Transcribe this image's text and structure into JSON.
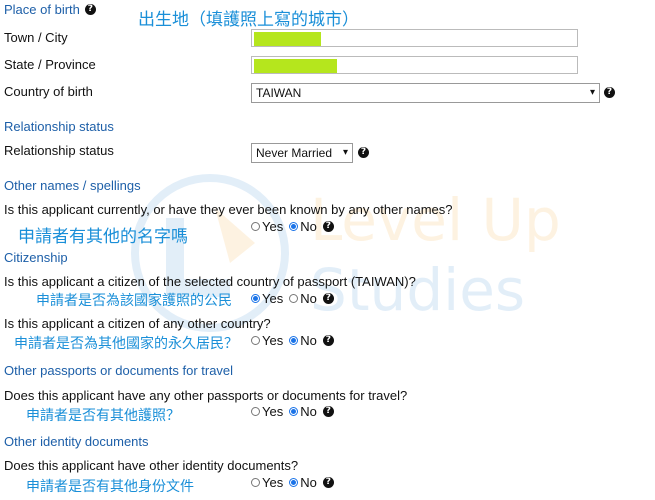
{
  "place_of_birth": {
    "section_title": "Place of birth",
    "annotation": "出生地（填護照上寫的城市）",
    "town_label": "Town / City",
    "state_label": "State / Province",
    "country_label": "Country of birth",
    "country_value": "TAIWAN"
  },
  "relationship": {
    "section_title": "Relationship status",
    "label": "Relationship status",
    "value": "Never Married"
  },
  "other_names": {
    "section_title": "Other names / spellings",
    "question": "Is this applicant currently, or have they ever been known by any other names?",
    "annotation": "申請者有其他的名字嗎",
    "selected": "No"
  },
  "citizenship": {
    "section_title": "Citizenship",
    "question1": "Is this applicant a citizen of the selected country of passport (TAIWAN)?",
    "annotation1": "申請者是否為該國家護照的公民",
    "selected1": "Yes",
    "question2": "Is this applicant a citizen of any other country?",
    "annotation2": "申請者是否為其他國家的永久居民？",
    "selected2": "No"
  },
  "other_passports": {
    "section_title": "Other passports or documents for travel",
    "question": "Does this applicant have any other passports or documents for travel?",
    "annotation": "申請者是否有其他護照？",
    "selected": "No"
  },
  "identity_docs": {
    "section_title": "Other identity documents",
    "question": "Does this applicant have other identity documents?",
    "annotation": "申請者是否有其他身份文件",
    "selected": "No"
  },
  "options": {
    "yes": "Yes",
    "no": "No"
  },
  "watermark": {
    "line1": "Level Up",
    "line2": "Studies"
  },
  "icons": {
    "help": "question-circle-icon",
    "dropdown": "chevron-down-icon"
  }
}
